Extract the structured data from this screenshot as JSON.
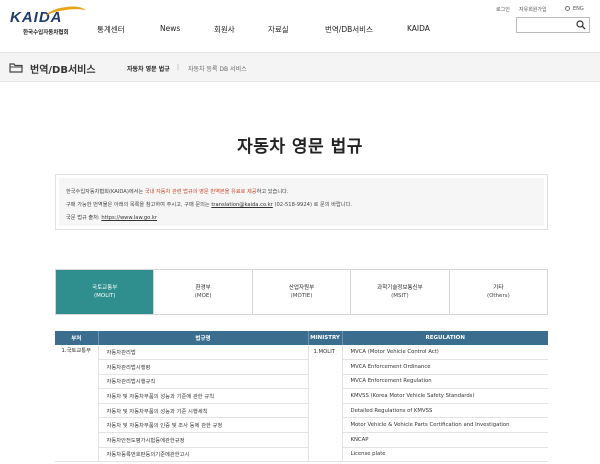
{
  "header": {
    "logo_text": "KAIDA",
    "logo_sub": "한국수입자동차협회",
    "nav": [
      "통계센터",
      "News",
      "회원사",
      "자료실",
      "번역/DB서비스",
      "KAIDA"
    ],
    "util": {
      "login": "로그인",
      "signup": "자유회원가입",
      "lang": "ENG"
    },
    "search_placeholder": ""
  },
  "subbar": {
    "title": "번역/DB서비스",
    "active": "자동차 영문 법규",
    "other": "자동차 등록 DB 서비스",
    "sep": "|"
  },
  "main": {
    "title": "자동차 영문 법규",
    "info": {
      "line1_a": "한국수입자동차협회(KAIDA)에서는 ",
      "line1_b": "국내 자동차 관련 법규의 영문 번역본을 유료로 제공",
      "line1_c": "하고 있습니다.",
      "line2_a": "구매 가능한 번역물은 아래의 목록을 참고하여 주시고, 구매 문의는 ",
      "line2_email": "translation@kaida.co.kr",
      "line2_b": " (02-518-9924) 로 문의 바랍니다.",
      "line3_a": "국문 법규 출처: ",
      "line3_link": "https://www.law.go.kr"
    },
    "tabs": [
      {
        "ko": "국토교통부",
        "en": "(MOLIT)"
      },
      {
        "ko": "환경부",
        "en": "(MOE)"
      },
      {
        "ko": "산업자원부",
        "en": "(MOTIE)"
      },
      {
        "ko": "과학기술정보통신부",
        "en": "(MSIT)"
      },
      {
        "ko": "기타",
        "en": "(Others)"
      }
    ],
    "table": {
      "headers": [
        "부처",
        "법규명",
        "MINISTRY",
        "REGULATION"
      ],
      "division": "1.국토교통부",
      "ministry": "1.MOLIT",
      "rows": [
        {
          "ko": "자동차관리법",
          "en": "MVCA (Motor Vehicle Control Act)"
        },
        {
          "ko": "자동차관리법시행령",
          "en": "MVCA Enforcement Ordinance"
        },
        {
          "ko": "자동차관리법시행규칙",
          "en": "MVCA Enforcement Regulation"
        },
        {
          "ko": "자동차 및 자동차부품의 성능과 기준에 관한 규칙",
          "en": "KMVSS (Korea Motor Vehicle Safety Standards)"
        },
        {
          "ko": "자동차 및 자동차부품의 성능과 기준 시행세칙",
          "en": "Detailed Regulations of KMVSS"
        },
        {
          "ko": "자동차 및 자동차부품의 인증 및 조사 등에 관한 규정",
          "en": "Motor Vehicle & Vehicle Parts Certification and Investigation"
        },
        {
          "ko": "자동차안전도평가시험등에관한규정",
          "en": "KNCAP"
        },
        {
          "ko": "자동차등록번호판등의기준에관한고시",
          "en": "License plate"
        }
      ]
    }
  }
}
